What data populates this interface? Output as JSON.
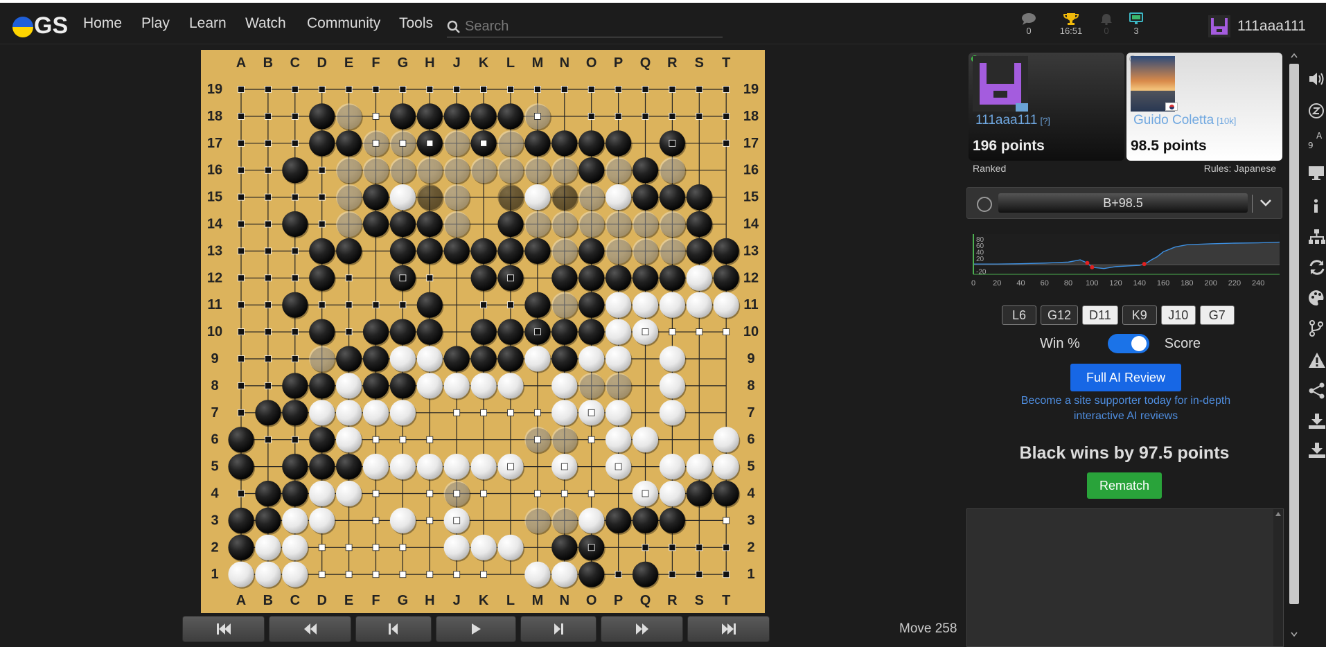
{
  "nav": {
    "logo_text": "GS",
    "items": [
      "Home",
      "Play",
      "Learn",
      "Watch",
      "Community",
      "Tools"
    ],
    "search_placeholder": "Search"
  },
  "top_icons": {
    "chat_count": "0",
    "tournament_time": "16:51",
    "notifications_count": "0",
    "games_count": "3"
  },
  "user": {
    "name": "111aaa111"
  },
  "board": {
    "columns": [
      "A",
      "B",
      "C",
      "D",
      "E",
      "F",
      "G",
      "H",
      "J",
      "K",
      "L",
      "M",
      "N",
      "O",
      "P",
      "Q",
      "R",
      "S",
      "T"
    ],
    "rows": [
      "19",
      "18",
      "17",
      "16",
      "15",
      "14",
      "13",
      "12",
      "11",
      "10",
      "9",
      "8",
      "7",
      "6",
      "5",
      "4",
      "3",
      "2",
      "1"
    ],
    "stones": [
      "...................",
      "...BW.BBBBBW.......",
      "...BBWWBWBWBBBB.B..",
      "..B.WWWWWWWWWBWBW..",
      "....WBWBW.BWBWWBBB.",
      "..B.WBBBW.BWWWWWWB.",
      "...BB.BBBBBBWBWWWBB",
      "...B..B..BB.BBBBBWB",
      "..B....B...BWBWWWWW",
      "...B.BBB.BBBBBWW...",
      "...WBBWWBBBWBWW.W..",
      "..BBWBBWWWW.WWW.W..",
      ".BBWWWW.....WWW.W..",
      "B..BW......WW.WW..W",
      "B.BBBWWWWWW.W.W.WWW",
      ".BBWW...W......WWBB",
      "BBWW..W.W..WWWBBB..",
      "BWW.....WWW.BB.....",
      "WWW........WWB.B..."
    ],
    "territory": [
      "BBBBBBBBBBBBBBBBBBB",
      "BBB..W.....W.BBBBBB",
      "BBB..WWW.W......B.B",
      "BB.B..................W",
      "BBBB..................B",
      "BB.B.................B",
      "BBB...................",
      "BBB.B.BB..B........",
      "BB.BBBB..BB...........",
      "BBB.B......B...WWWW",
      "BBB.................",
      "BB.......................",
      "B.......WWWW.W.....",
      ".BB..WWW...W.W......",
      "..........W.W.W.....",
      "B....W.WWW.WWW.W...",
      ".....W.WW.........W",
      "...WWWW......B.BBBB",
      "...WWWWWWW....B.BBB"
    ],
    "dead": [
      "...................",
      "....W......W.......",
      ".....WW.W.W........",
      "....WWWWWWWWW.W.W..",
      "....W..WW.W.WW.....",
      "....W...W..WWWWWW..",
      "............W.WWW..",
      "...................",
      "............W......",
      "...................",
      "...W...............",
      ".............BBB.B.",
      "...............B.B.",
      ".........B.BB...BB.",
      "...........B.......",
      "......BBBBB..B.....",
      "..........BBB......",
      "...........B.......",
      "..................."
    ]
  },
  "controls": {
    "move_label": "Move 258"
  },
  "players": {
    "black": {
      "name": "111aaa111",
      "rank": "[?]",
      "points": "196 points"
    },
    "white": {
      "name": "Guido Coletta",
      "rank": "[10k]",
      "points": "98.5 points"
    }
  },
  "game_info": {
    "ranked": "Ranked",
    "rules": "Rules: Japanese"
  },
  "score_estimate": "B+98.5",
  "chart_data": {
    "type": "line",
    "x_ticks": [
      "0",
      "20",
      "40",
      "60",
      "80",
      "100",
      "120",
      "140",
      "160",
      "180",
      "200",
      "220",
      "240"
    ],
    "y_ticks": [
      "80",
      "60",
      "40",
      "20",
      "-20"
    ],
    "xlim": [
      0,
      258
    ],
    "ylim": [
      -30,
      95
    ],
    "x": [
      0,
      20,
      40,
      60,
      80,
      90,
      96,
      100,
      110,
      120,
      130,
      140,
      145,
      150,
      155,
      160,
      170,
      180,
      200,
      220,
      240,
      258
    ],
    "y": [
      2,
      2,
      3,
      5,
      8,
      15,
      5,
      -8,
      -12,
      -6,
      -4,
      -2,
      3,
      15,
      25,
      40,
      55,
      62,
      65,
      67,
      68,
      70
    ],
    "markers": [
      96,
      100,
      144
    ]
  },
  "variations": [
    {
      "label": "L6",
      "style": "dark"
    },
    {
      "label": "G12",
      "style": "dark"
    },
    {
      "label": "D11",
      "style": "light"
    },
    {
      "label": "K9",
      "style": "dark"
    },
    {
      "label": "J10",
      "style": "light"
    },
    {
      "label": "G7",
      "style": "light"
    }
  ],
  "toggle": {
    "left": "Win %",
    "right": "Score"
  },
  "ai_review": {
    "button": "Full AI Review",
    "support_text": "Become a site supporter today for in-depth interactive AI reviews"
  },
  "result": {
    "text": "Black wins by 97.5 points",
    "rematch": "Rematch"
  }
}
